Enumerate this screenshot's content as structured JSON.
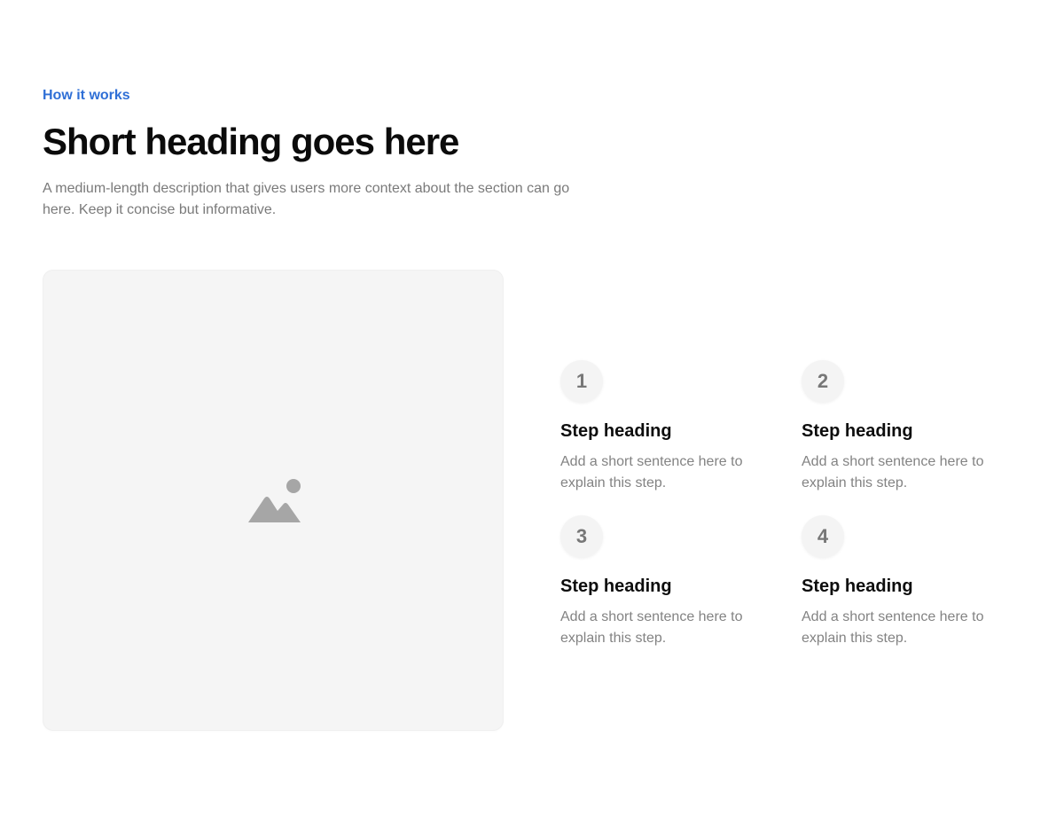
{
  "section": {
    "eyebrow": "How it works",
    "title": "Short heading goes here",
    "description": "A medium-length description that gives users more context about the section can go here. Keep it concise but informative."
  },
  "media": {
    "icon": "image-placeholder-icon"
  },
  "steps": [
    {
      "number": "1",
      "heading": "Step heading",
      "text": "Add a short sentence here to explain this step."
    },
    {
      "number": "2",
      "heading": "Step heading",
      "text": "Add a short sentence here to explain this step."
    },
    {
      "number": "3",
      "heading": "Step heading",
      "text": "Add a short sentence here to explain this step."
    },
    {
      "number": "4",
      "heading": "Step heading",
      "text": "Add a short sentence here to explain this step."
    }
  ],
  "colors": {
    "accent": "#2f6fd6",
    "heading": "#0b0b0b",
    "muted_text": "#7a7a7a",
    "placeholder_bg": "#f5f5f5",
    "placeholder_icon": "#a6a6a6"
  }
}
